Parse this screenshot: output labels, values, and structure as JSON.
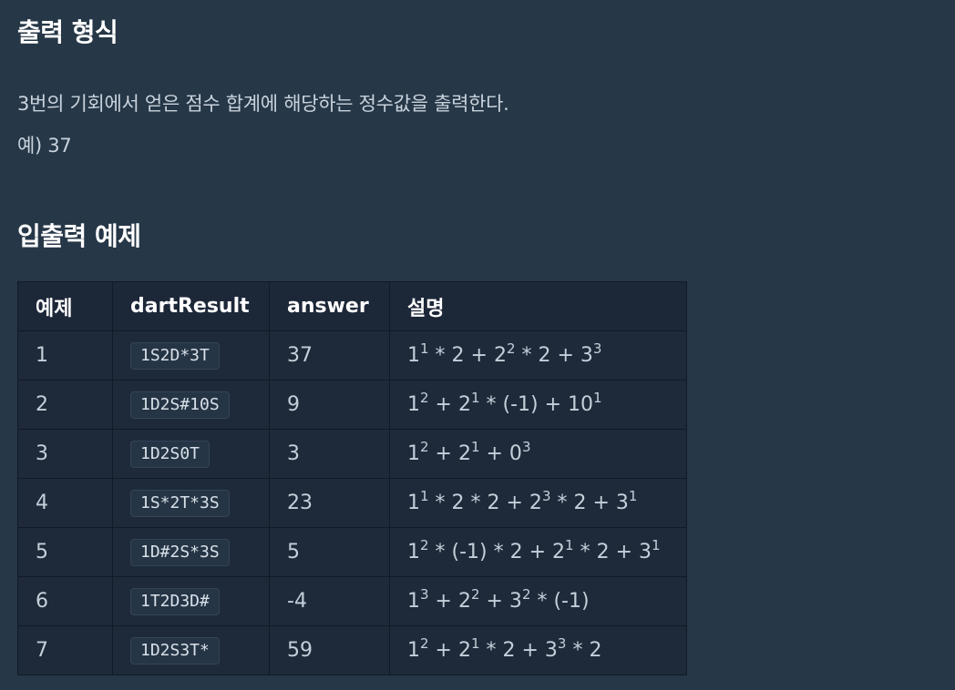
{
  "output_format": {
    "heading": "출력 형식",
    "line1": "3번의 기회에서 얻은 점수 합계에 해당하는 정수값을 출력한다.",
    "line2": "예) 37"
  },
  "examples": {
    "heading": "입출력 예제",
    "columns": [
      "예제",
      "dartResult",
      "answer",
      "설명"
    ],
    "rows": [
      {
        "no": "1",
        "dartResult": "1S2D*3T",
        "answer": "37",
        "expl": [
          [
            "1",
            "1"
          ],
          [
            " * 2 + 2",
            "2"
          ],
          [
            " * 2 + 3",
            "3"
          ]
        ]
      },
      {
        "no": "2",
        "dartResult": "1D2S#10S",
        "answer": "9",
        "expl": [
          [
            "1",
            "2"
          ],
          [
            " + 2",
            "1"
          ],
          [
            " * (-1) + 10",
            "1"
          ]
        ]
      },
      {
        "no": "3",
        "dartResult": "1D2S0T",
        "answer": "3",
        "expl": [
          [
            "1",
            "2"
          ],
          [
            " + 2",
            "1"
          ],
          [
            " + 0",
            "3"
          ]
        ]
      },
      {
        "no": "4",
        "dartResult": "1S*2T*3S",
        "answer": "23",
        "expl": [
          [
            "1",
            "1"
          ],
          [
            " * 2 * 2 + 2",
            "3"
          ],
          [
            " * 2 + 3",
            "1"
          ]
        ]
      },
      {
        "no": "5",
        "dartResult": "1D#2S*3S",
        "answer": "5",
        "expl": [
          [
            "1",
            "2"
          ],
          [
            " * (-1) * 2 + 2",
            "1"
          ],
          [
            " * 2 + 3",
            "1"
          ]
        ]
      },
      {
        "no": "6",
        "dartResult": "1T2D3D#",
        "answer": "-4",
        "expl": [
          [
            "1",
            "3"
          ],
          [
            " + 2",
            "2"
          ],
          [
            " + 3",
            "2"
          ],
          [
            " * (-1)",
            ""
          ]
        ]
      },
      {
        "no": "7",
        "dartResult": "1D2S3T*",
        "answer": "59",
        "expl": [
          [
            "1",
            "2"
          ],
          [
            " + 2",
            "1"
          ],
          [
            " * 2 + 3",
            "3"
          ],
          [
            " * 2",
            ""
          ]
        ]
      }
    ]
  }
}
